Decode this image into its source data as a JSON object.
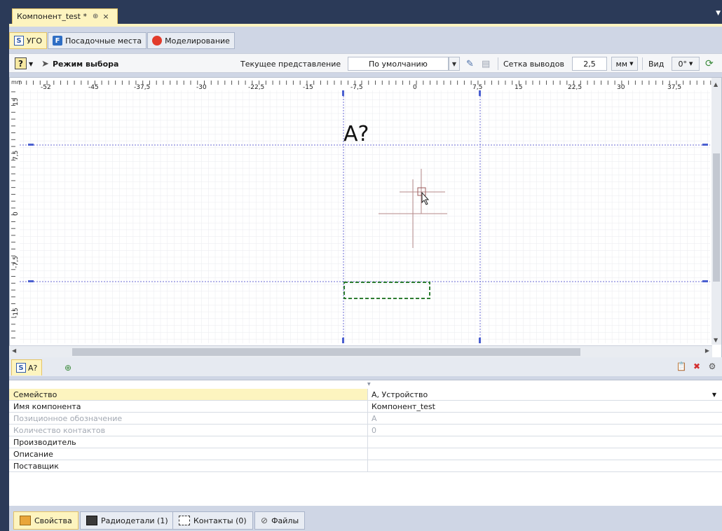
{
  "doc_tab": {
    "title": "Компонент_test *",
    "pin": "⊕",
    "close": "×"
  },
  "top_tabs": [
    {
      "label": "УГО",
      "icon": "S"
    },
    {
      "label": "Посадочные места",
      "icon": "F"
    },
    {
      "label": "Моделирование",
      "icon": "M"
    }
  ],
  "toolbar": {
    "help_glyph": "?",
    "mode_label": "Режим выбора",
    "view_repr_label": "Текущее представление",
    "view_repr_value": "По умолчанию",
    "grid_label": "Сетка выводов",
    "grid_value": "2,5",
    "unit_value": "мм",
    "view_label": "Вид",
    "rotation_value": "0°"
  },
  "canvas": {
    "ruler_unit": "mm",
    "x_ticks": [
      "-52",
      "-45",
      "-37,5",
      "-30",
      "-22,5",
      "-15",
      "-7,5",
      "0",
      "7,5",
      "15",
      "22,5",
      "30",
      "37,5"
    ],
    "y_ticks": [
      "15",
      "7,5",
      "0",
      "-7,5",
      "-15"
    ],
    "ref_label": "A?"
  },
  "inner_tabs": [
    {
      "label": "A?"
    },
    {
      "label": ""
    }
  ],
  "properties": [
    {
      "name": "Семейство",
      "value": "А, Устройство",
      "dim": false,
      "selected": true
    },
    {
      "name": "Имя компонента",
      "value": "Компонент_test",
      "dim": false,
      "selected": false
    },
    {
      "name": "Позиционное обозначение",
      "value": "А",
      "dim": true,
      "selected": false
    },
    {
      "name": "Количество контактов",
      "value": "0",
      "dim": true,
      "selected": false
    },
    {
      "name": "Производитель",
      "value": "",
      "dim": false,
      "selected": false
    },
    {
      "name": "Описание",
      "value": "",
      "dim": false,
      "selected": false
    },
    {
      "name": "Поставщик",
      "value": "",
      "dim": false,
      "selected": false
    }
  ],
  "bottom_tabs": [
    {
      "label": "Свойства"
    },
    {
      "label": "Радиодетали (1)"
    },
    {
      "label": "Контакты (0)"
    },
    {
      "label": "Файлы"
    }
  ],
  "colors": {
    "accent": "#fdf4bf",
    "frame": "#2b3a58",
    "guide": "#6b6bd6",
    "pin_rect": "#2e7d32"
  }
}
